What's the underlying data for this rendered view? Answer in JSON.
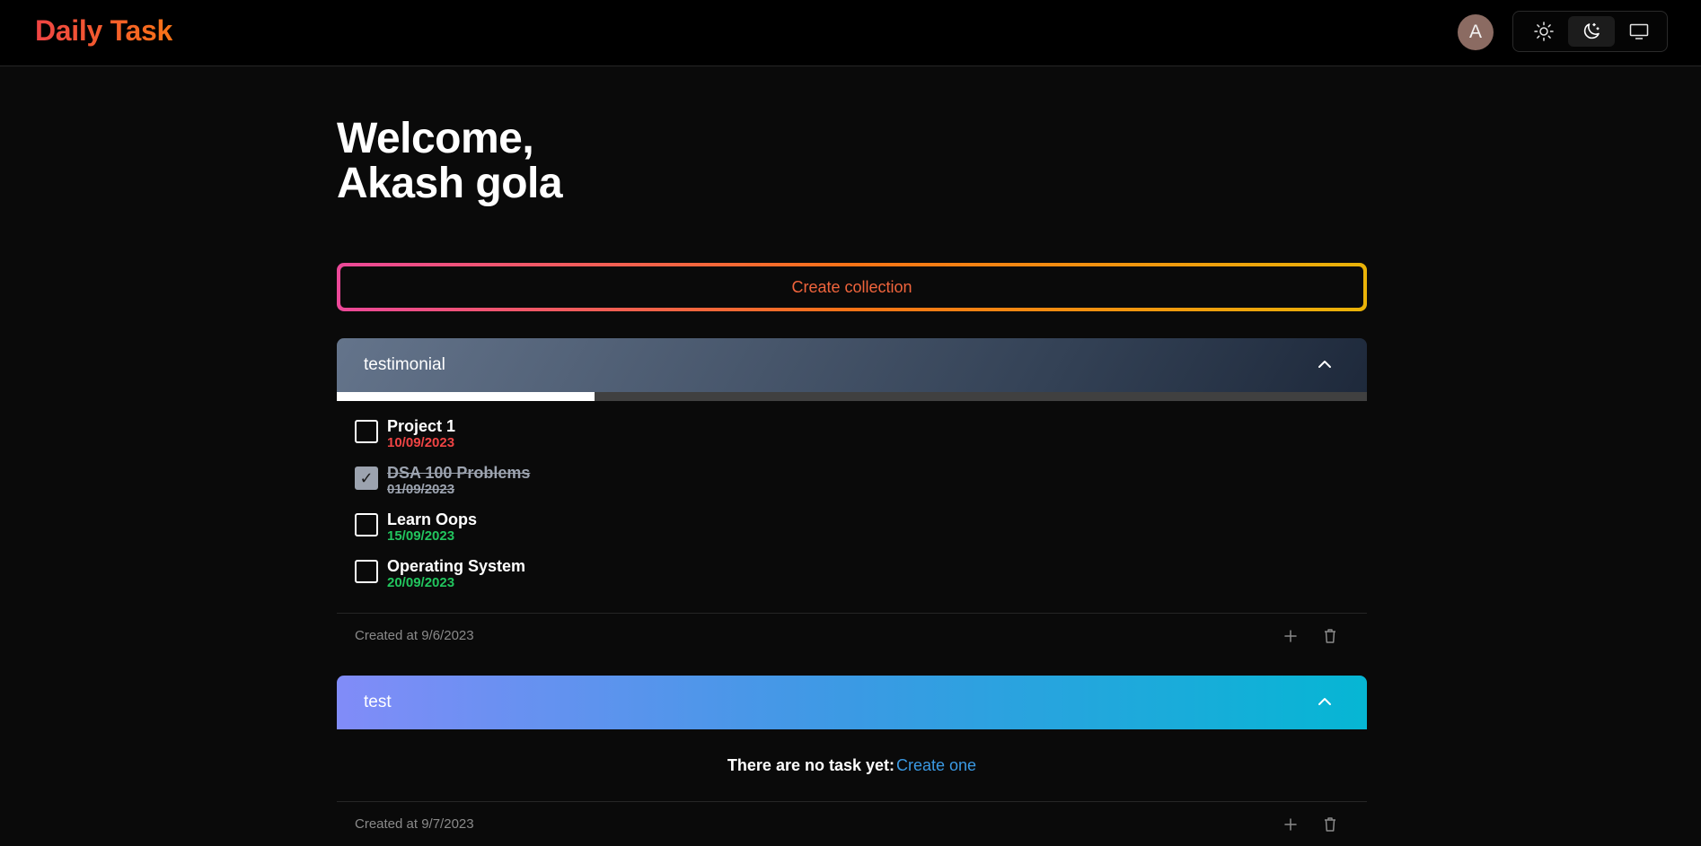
{
  "header": {
    "brand": "Daily Task",
    "avatar_initial": "A",
    "theme_options": [
      "light",
      "dark",
      "system"
    ],
    "active_theme": "dark"
  },
  "welcome": {
    "line1": "Welcome,",
    "line2": "Akash gola"
  },
  "create_collection_label": "Create collection",
  "collections": [
    {
      "name": "testimonial",
      "color_theme": "slate",
      "progress_percent": 25,
      "tasks": [
        {
          "title": "Project 1",
          "date": "10/09/2023",
          "done": false,
          "date_color": "#ef4444"
        },
        {
          "title": "DSA 100 Problems",
          "date": "01/09/2023",
          "done": true,
          "date_color": "#9ca3af"
        },
        {
          "title": "Learn Oops",
          "date": "15/09/2023",
          "done": false,
          "date_color": "#22c55e"
        },
        {
          "title": "Operating System",
          "date": "20/09/2023",
          "done": false,
          "date_color": "#22c55e"
        }
      ],
      "created_at": "Created at 9/6/2023"
    },
    {
      "name": "test",
      "color_theme": "blue-cyan",
      "empty_text": "There are no task yet:",
      "empty_link": "Create one",
      "created_at": "Created at 9/7/2023"
    }
  ]
}
